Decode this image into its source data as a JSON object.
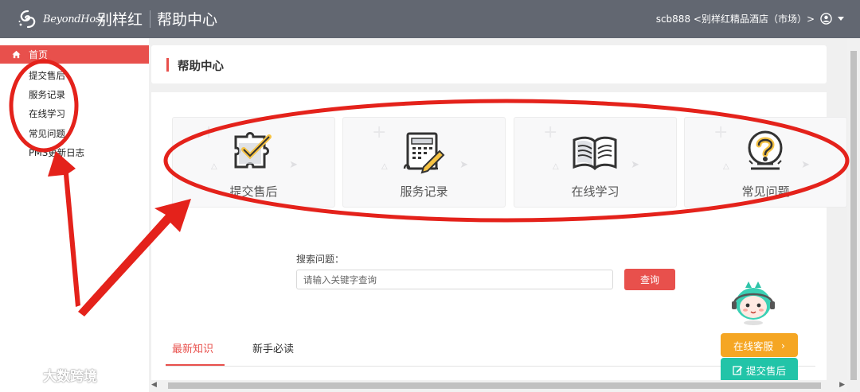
{
  "header": {
    "logo_text": "BeyondHost",
    "app_title": "别样红",
    "page_title": "帮助中心",
    "user_label": "scb888 <别样红精品酒店（市场）>"
  },
  "sidebar": {
    "home": "首页",
    "items": [
      "提交售后",
      "服务记录",
      "在线学习",
      "常见问题",
      "PMS更新日志"
    ]
  },
  "page": {
    "title": "帮助中心"
  },
  "tiles": [
    {
      "label": "提交售后",
      "icon": "puzzle-check-icon"
    },
    {
      "label": "服务记录",
      "icon": "record-pen-icon"
    },
    {
      "label": "在线学习",
      "icon": "open-book-icon"
    },
    {
      "label": "常见问题",
      "icon": "question-bulb-icon"
    }
  ],
  "search": {
    "label": "搜索问题：",
    "placeholder": "请输入关键字查询",
    "button": "查询"
  },
  "tabs": [
    "最新知识",
    "新手必读"
  ],
  "floating": {
    "service": "在线客服",
    "service_arrow": "›",
    "ticket": "提交售后"
  },
  "watermark": "大数跨境",
  "colors": {
    "header": "#626771",
    "accent": "#e8504c",
    "service": "#f5a623",
    "ticket": "#22c4a8",
    "annotation": "#e4221b"
  }
}
